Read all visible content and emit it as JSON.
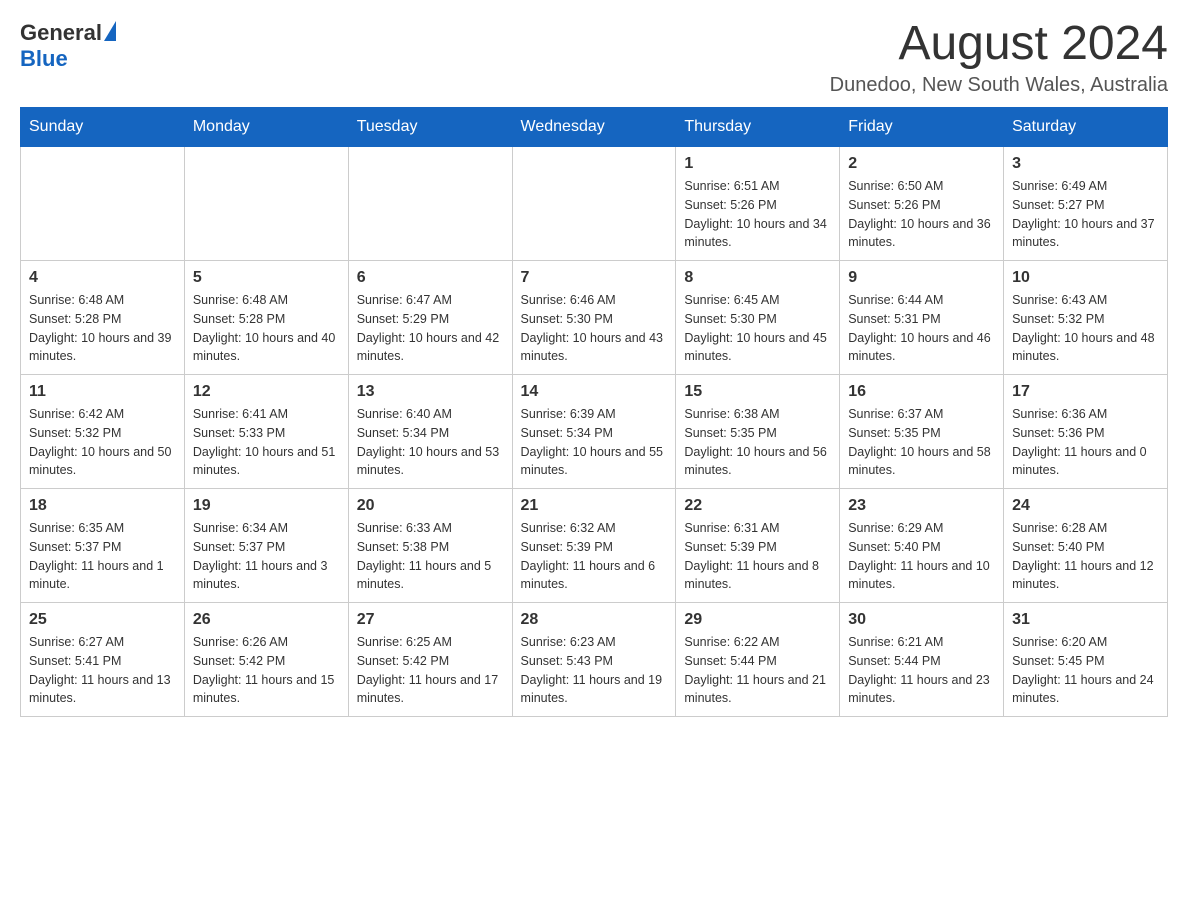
{
  "header": {
    "logo_general": "General",
    "logo_blue": "Blue",
    "month_year": "August 2024",
    "location": "Dunedoo, New South Wales, Australia"
  },
  "days_of_week": [
    "Sunday",
    "Monday",
    "Tuesday",
    "Wednesday",
    "Thursday",
    "Friday",
    "Saturday"
  ],
  "weeks": [
    [
      {
        "day": "",
        "info": ""
      },
      {
        "day": "",
        "info": ""
      },
      {
        "day": "",
        "info": ""
      },
      {
        "day": "",
        "info": ""
      },
      {
        "day": "1",
        "info": "Sunrise: 6:51 AM\nSunset: 5:26 PM\nDaylight: 10 hours and 34 minutes."
      },
      {
        "day": "2",
        "info": "Sunrise: 6:50 AM\nSunset: 5:26 PM\nDaylight: 10 hours and 36 minutes."
      },
      {
        "day": "3",
        "info": "Sunrise: 6:49 AM\nSunset: 5:27 PM\nDaylight: 10 hours and 37 minutes."
      }
    ],
    [
      {
        "day": "4",
        "info": "Sunrise: 6:48 AM\nSunset: 5:28 PM\nDaylight: 10 hours and 39 minutes."
      },
      {
        "day": "5",
        "info": "Sunrise: 6:48 AM\nSunset: 5:28 PM\nDaylight: 10 hours and 40 minutes."
      },
      {
        "day": "6",
        "info": "Sunrise: 6:47 AM\nSunset: 5:29 PM\nDaylight: 10 hours and 42 minutes."
      },
      {
        "day": "7",
        "info": "Sunrise: 6:46 AM\nSunset: 5:30 PM\nDaylight: 10 hours and 43 minutes."
      },
      {
        "day": "8",
        "info": "Sunrise: 6:45 AM\nSunset: 5:30 PM\nDaylight: 10 hours and 45 minutes."
      },
      {
        "day": "9",
        "info": "Sunrise: 6:44 AM\nSunset: 5:31 PM\nDaylight: 10 hours and 46 minutes."
      },
      {
        "day": "10",
        "info": "Sunrise: 6:43 AM\nSunset: 5:32 PM\nDaylight: 10 hours and 48 minutes."
      }
    ],
    [
      {
        "day": "11",
        "info": "Sunrise: 6:42 AM\nSunset: 5:32 PM\nDaylight: 10 hours and 50 minutes."
      },
      {
        "day": "12",
        "info": "Sunrise: 6:41 AM\nSunset: 5:33 PM\nDaylight: 10 hours and 51 minutes."
      },
      {
        "day": "13",
        "info": "Sunrise: 6:40 AM\nSunset: 5:34 PM\nDaylight: 10 hours and 53 minutes."
      },
      {
        "day": "14",
        "info": "Sunrise: 6:39 AM\nSunset: 5:34 PM\nDaylight: 10 hours and 55 minutes."
      },
      {
        "day": "15",
        "info": "Sunrise: 6:38 AM\nSunset: 5:35 PM\nDaylight: 10 hours and 56 minutes."
      },
      {
        "day": "16",
        "info": "Sunrise: 6:37 AM\nSunset: 5:35 PM\nDaylight: 10 hours and 58 minutes."
      },
      {
        "day": "17",
        "info": "Sunrise: 6:36 AM\nSunset: 5:36 PM\nDaylight: 11 hours and 0 minutes."
      }
    ],
    [
      {
        "day": "18",
        "info": "Sunrise: 6:35 AM\nSunset: 5:37 PM\nDaylight: 11 hours and 1 minute."
      },
      {
        "day": "19",
        "info": "Sunrise: 6:34 AM\nSunset: 5:37 PM\nDaylight: 11 hours and 3 minutes."
      },
      {
        "day": "20",
        "info": "Sunrise: 6:33 AM\nSunset: 5:38 PM\nDaylight: 11 hours and 5 minutes."
      },
      {
        "day": "21",
        "info": "Sunrise: 6:32 AM\nSunset: 5:39 PM\nDaylight: 11 hours and 6 minutes."
      },
      {
        "day": "22",
        "info": "Sunrise: 6:31 AM\nSunset: 5:39 PM\nDaylight: 11 hours and 8 minutes."
      },
      {
        "day": "23",
        "info": "Sunrise: 6:29 AM\nSunset: 5:40 PM\nDaylight: 11 hours and 10 minutes."
      },
      {
        "day": "24",
        "info": "Sunrise: 6:28 AM\nSunset: 5:40 PM\nDaylight: 11 hours and 12 minutes."
      }
    ],
    [
      {
        "day": "25",
        "info": "Sunrise: 6:27 AM\nSunset: 5:41 PM\nDaylight: 11 hours and 13 minutes."
      },
      {
        "day": "26",
        "info": "Sunrise: 6:26 AM\nSunset: 5:42 PM\nDaylight: 11 hours and 15 minutes."
      },
      {
        "day": "27",
        "info": "Sunrise: 6:25 AM\nSunset: 5:42 PM\nDaylight: 11 hours and 17 minutes."
      },
      {
        "day": "28",
        "info": "Sunrise: 6:23 AM\nSunset: 5:43 PM\nDaylight: 11 hours and 19 minutes."
      },
      {
        "day": "29",
        "info": "Sunrise: 6:22 AM\nSunset: 5:44 PM\nDaylight: 11 hours and 21 minutes."
      },
      {
        "day": "30",
        "info": "Sunrise: 6:21 AM\nSunset: 5:44 PM\nDaylight: 11 hours and 23 minutes."
      },
      {
        "day": "31",
        "info": "Sunrise: 6:20 AM\nSunset: 5:45 PM\nDaylight: 11 hours and 24 minutes."
      }
    ]
  ]
}
